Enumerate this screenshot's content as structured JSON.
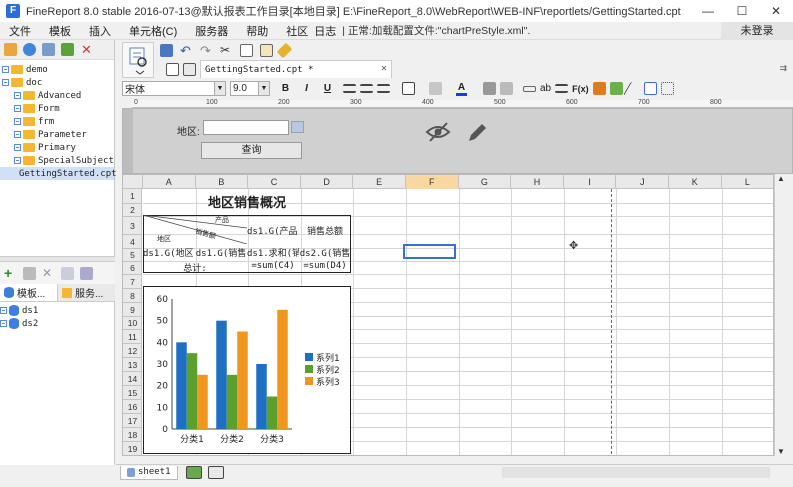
{
  "window": {
    "title": "FineReport 8.0 stable 2016-07-13@默认报表工作目录[本地目录]   E:\\FineReport_8.0\\WebReport\\WEB-INF\\reportlets/GettingStarted.cpt",
    "controls": [
      "—",
      "☐",
      "✕"
    ]
  },
  "menubar": {
    "items": [
      "文件",
      "模板",
      "插入",
      "单元格(C)",
      "服务器",
      "帮助",
      "社区",
      "日志"
    ],
    "status": "| 正常:加载配置文件:\"chartPreStyle.xml\".",
    "login": "未登录"
  },
  "tree": {
    "items": [
      {
        "label": "demo",
        "level": 0,
        "type": "folder"
      },
      {
        "label": "doc",
        "level": 0,
        "type": "folder"
      },
      {
        "label": "Advanced",
        "level": 1,
        "type": "folder"
      },
      {
        "label": "Form",
        "level": 1,
        "type": "folder"
      },
      {
        "label": "frm",
        "level": 1,
        "type": "folder"
      },
      {
        "label": "Parameter",
        "level": 1,
        "type": "folder"
      },
      {
        "label": "Primary",
        "level": 1,
        "type": "folder"
      },
      {
        "label": "SpecialSubject",
        "level": 1,
        "type": "folder"
      },
      {
        "label": "GettingStarted.cpt",
        "level": 1,
        "type": "file",
        "selected": true
      }
    ]
  },
  "datasource": {
    "tabs": [
      "模板...",
      "服务..."
    ],
    "items": [
      "ds1",
      "ds2"
    ]
  },
  "editor": {
    "tab_label": "GettingStarted.cpt *",
    "tab_close": "✕",
    "font_name": "宋体",
    "font_size": "9.0",
    "fmt": {
      "bold": "B",
      "italic": "I",
      "underline": "U",
      "fx": "F(x)",
      "ab": "ab",
      "font_color": "A"
    },
    "ruler_ticks": [
      "0",
      "100",
      "200",
      "300",
      "400",
      "500",
      "600",
      "700",
      "800"
    ]
  },
  "param": {
    "label": "地区:",
    "query_button": "查询"
  },
  "grid": {
    "columns": [
      "A",
      "B",
      "C",
      "D",
      "E",
      "F",
      "G",
      "H",
      "I",
      "J",
      "K",
      "L"
    ],
    "selected_column": "F",
    "rows": [
      "1",
      "2",
      "3",
      "4",
      "5",
      "6",
      "7",
      "8",
      "9",
      "10",
      "11",
      "12",
      "13",
      "14",
      "15",
      "16",
      "17",
      "18",
      "19"
    ],
    "report_title": "地区销售概况",
    "diag_top": "产品",
    "diag_mid": "销售额",
    "diag_bottom": "地区",
    "c3": "ds1.G(产品)",
    "d3": "销售总额",
    "a4": "ds1.G(地区)",
    "b4": "ds1.G(销售",
    "c4": "ds1.求和(销",
    "d4": "ds2.G(销售",
    "ab5": "总计:",
    "c5": "=sum(C4)",
    "d5": "=sum(D4)"
  },
  "sheets": {
    "tab": "sheet1"
  },
  "chart_data": {
    "type": "bar",
    "categories": [
      "分类1",
      "分类2",
      "分类3"
    ],
    "series": [
      {
        "name": "系列1",
        "values": [
          40,
          50,
          30
        ],
        "color": "#1f6fc4"
      },
      {
        "name": "系列2",
        "values": [
          35,
          25,
          15
        ],
        "color": "#5aa02c"
      },
      {
        "name": "系列3",
        "values": [
          25,
          45,
          55
        ],
        "color": "#f0961e"
      }
    ],
    "yticks": [
      "0",
      "10",
      "20",
      "30",
      "40",
      "50",
      "60"
    ],
    "ylim": [
      0,
      60
    ],
    "legend": "right"
  }
}
